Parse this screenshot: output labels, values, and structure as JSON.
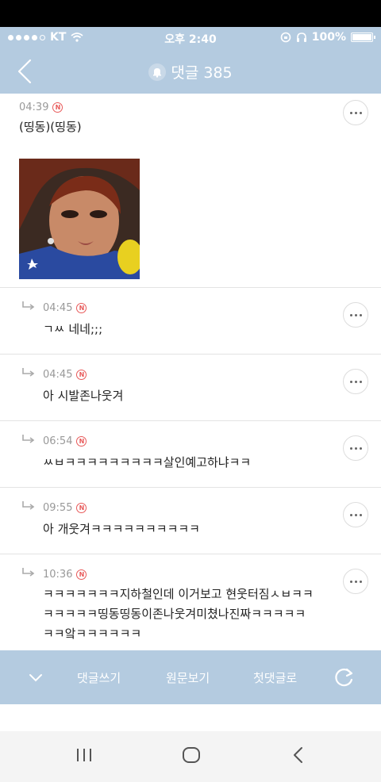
{
  "status": {
    "carrier": "KT",
    "time": "오후 2:40",
    "battery": "100%",
    "icons": [
      "signal-dots",
      "wifi-icon",
      "rotation-lock-icon",
      "headphones-icon",
      "battery-icon"
    ]
  },
  "header": {
    "title": "댓글 385",
    "icons": [
      "back-arrow-icon",
      "bell-icon"
    ]
  },
  "new_badge": "N",
  "comments": [
    {
      "time": "04:39",
      "text": "(띵동)(띵동)",
      "is_reply": false,
      "has_image": true,
      "image_icon": "portrait-photo"
    },
    {
      "time": "04:45",
      "text": "ㄱㅆ 네네;;;",
      "is_reply": true
    },
    {
      "time": "04:45",
      "text": "아 시발존나웃겨",
      "is_reply": true
    },
    {
      "time": "06:54",
      "text": "ㅆㅂㅋㅋㅋㅋㅋㅋㅋㅋㅋ살인예고하냐ㅋㅋ",
      "is_reply": true
    },
    {
      "time": "09:55",
      "text": "아 개웃겨ㅋㅋㅋㅋㅋㅋㅋㅋㅋㅋ",
      "is_reply": true
    },
    {
      "time": "10:36",
      "is_reply": true,
      "lines": [
        "ㅋㅋㅋㅋㅋㅋㅋ지하철인데 이거보고 현웃터짐ㅅㅂㅋㅋ",
        "ㅋㅋㅋㅋㅋ띵동띵동이존나웃겨미쳤나진짜ㅋㅋㅋㅋㅋ",
        "ㅋㅋ앜ㅋㅋㅋㅋㅋㅋ"
      ]
    }
  ],
  "toolbar": {
    "write": "댓글쓰기",
    "original": "원문보기",
    "first": "첫댓글로",
    "icons": [
      "chevron-down-icon",
      "refresh-icon"
    ]
  },
  "nav": {
    "icons": [
      "recents-icon",
      "home-icon",
      "back-icon"
    ]
  },
  "colors": {
    "accent": "#b4cbe0",
    "badge": "#e85a5a",
    "meta": "#999999"
  }
}
